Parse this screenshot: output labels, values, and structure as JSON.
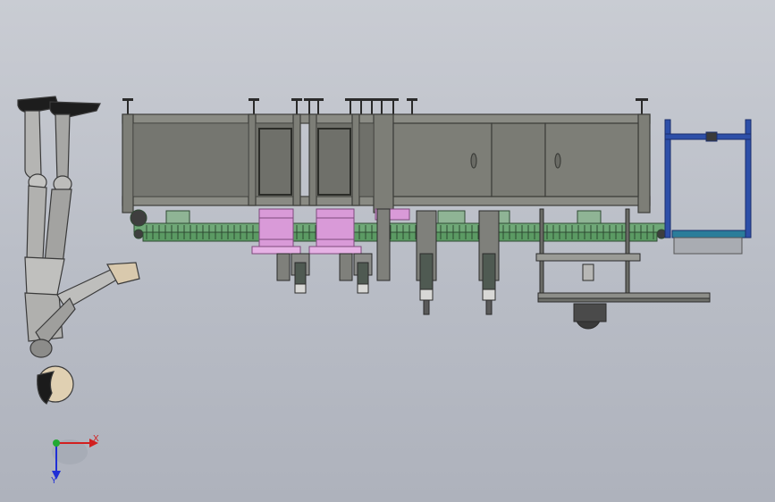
{
  "triad": {
    "x_label": "X",
    "y_label": "Y",
    "x_color": "#d21f1f",
    "y_color": "#1f2fd6",
    "z_color": "#22aa33"
  },
  "colors": {
    "background_top": "#c9ccd3",
    "background_bottom": "#aeb2bc",
    "frame_gray": "#7d7e77",
    "frame_edge": "#3d3e3a",
    "conveyor_green": "#5b9a63",
    "roller_pink": "#d99ad8",
    "rack_blue": "#2d4fa8",
    "belt_teal": "#2b7d9a"
  },
  "icons": {
    "view_triad": "view-triad-icon",
    "mannequin": "mannequin-icon"
  }
}
